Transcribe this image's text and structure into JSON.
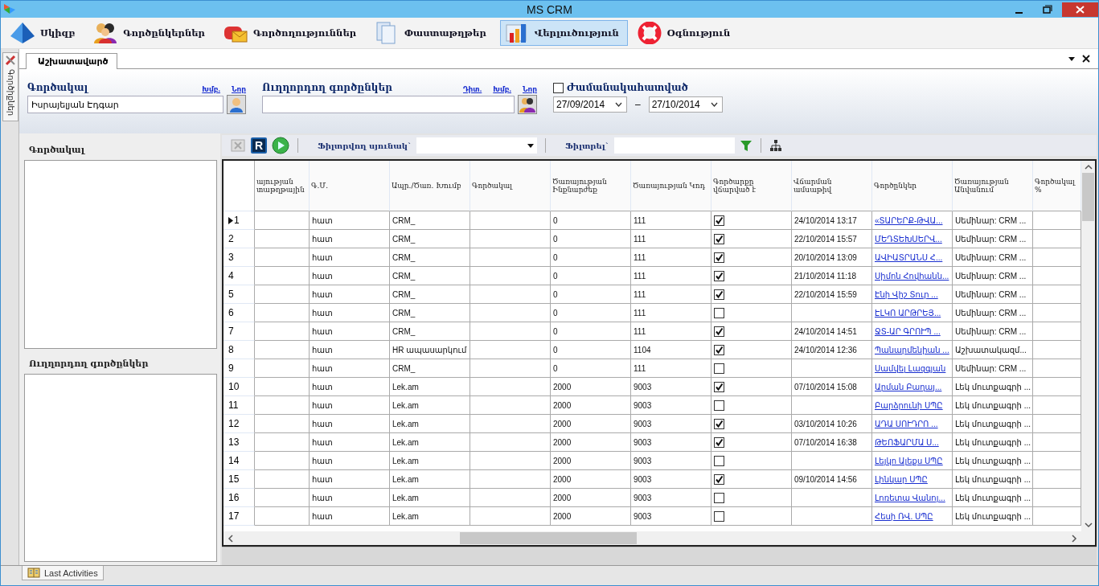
{
  "window": {
    "title": "MS CRM"
  },
  "menu": [
    {
      "label": "Սկիզբ",
      "selected": false
    },
    {
      "label": "Գործընկերներ",
      "selected": false
    },
    {
      "label": "Գործողություններ",
      "selected": false
    },
    {
      "label": "Փաստաթղթեր",
      "selected": false
    },
    {
      "label": "Վերլուծություն",
      "selected": true
    },
    {
      "label": "Օգնություն",
      "selected": false
    }
  ],
  "side_strip": {
    "label": "Գործիքներ"
  },
  "doc_tab": {
    "label": "Աշխատավարծ"
  },
  "form": {
    "agent": {
      "label": "Գործակալ",
      "links": [
        "Խմբ.",
        "Նոր"
      ],
      "value": "Իսրայելյան Էդգար"
    },
    "partner": {
      "label": "Ուղղորդող գործընկեր",
      "links": [
        "Դիտ.",
        "Խմբ.",
        "Նոր"
      ]
    },
    "period": {
      "label": "Ժամանակահատված",
      "checked": false,
      "from": "27/09/2014",
      "separator": "–",
      "to": "27/10/2014"
    }
  },
  "left_panel": {
    "agent_label": "Գործակալ",
    "partner_label": "Ուղղորդող գործընկեր"
  },
  "toolbar": {
    "report_button": "R",
    "filter_column_label": "Ֆիլտրվող սյունակ`",
    "filter_label": "Ֆիլտրել`"
  },
  "table": {
    "columns": [
      "այության տաթղթային",
      "Գ.Մ.",
      "Ապր./Ծառ. Խումբ",
      "Գործակալ",
      "Ծառայության Ինքնարժեք",
      "Ծառայության Կոդ",
      "Գործարքը վճարված է",
      "Վճարման ամսաթիվ",
      "Գործընկեր",
      "Ծառայության Անվանում",
      "Գործակալ %"
    ],
    "rows": [
      {
        "num": "1",
        "selected": true,
        "unit": "հատ",
        "group": "CRM_",
        "cost": "0",
        "code": "111",
        "paid": true,
        "date": "24/10/2014 13:17",
        "partner": "«ՏԱՐԵՐՔ-ԹՎԱ...",
        "service": "Սեմինար: CRM ..."
      },
      {
        "num": "2",
        "selected": false,
        "unit": "հատ",
        "group": "CRM_",
        "cost": "0",
        "code": "111",
        "paid": true,
        "date": "22/10/2014 15:57",
        "partner": "ՄԵԴՏԵԽՍԵՐՎ...",
        "service": "Սեմինար: CRM ..."
      },
      {
        "num": "3",
        "selected": false,
        "unit": "հատ",
        "group": "CRM_",
        "cost": "0",
        "code": "111",
        "paid": true,
        "date": "20/10/2014 13:09",
        "partner": "ԱՎԻԱՏՐԱՆՍ Հ...",
        "service": "Սեմինար: CRM ..."
      },
      {
        "num": "4",
        "selected": false,
        "unit": "հատ",
        "group": "CRM_",
        "cost": "0",
        "code": "111",
        "paid": true,
        "date": "21/10/2014 11:18",
        "partner": "Սիմոն Հովհանն...",
        "service": "Սեմինար: CRM ..."
      },
      {
        "num": "5",
        "selected": false,
        "unit": "հատ",
        "group": "CRM_",
        "cost": "0",
        "code": "111",
        "paid": true,
        "date": "22/10/2014 15:59",
        "partner": "Էնի Վիշ Տուր ...",
        "service": "Սեմինար: CRM ..."
      },
      {
        "num": "6",
        "selected": false,
        "unit": "հատ",
        "group": "CRM_",
        "cost": "0",
        "code": "111",
        "paid": false,
        "date": "",
        "partner": "ԷԼԿՈ ԱՐԹՐԵՅ...",
        "service": "Սեմինար: CRM ..."
      },
      {
        "num": "7",
        "selected": false,
        "unit": "հատ",
        "group": "CRM_",
        "cost": "0",
        "code": "111",
        "paid": true,
        "date": "24/10/2014 14:51",
        "partner": "ՋՏ-ԱՐ ԳՐՈՒՊ ...",
        "service": "Սեմինար: CRM ..."
      },
      {
        "num": "8",
        "selected": false,
        "unit": "հատ",
        "group": "HR ապասարկում",
        "cost": "0",
        "code": "1104",
        "paid": true,
        "date": "24/10/2014 12:36",
        "partner": "Պանարմենիան ...",
        "service": "Աշխատակազմ..."
      },
      {
        "num": "9",
        "selected": false,
        "unit": "հատ",
        "group": "CRM_",
        "cost": "0",
        "code": "111",
        "paid": false,
        "date": "",
        "partner": "Սամվել Լազգյան",
        "service": "Սեմինար: CRM ..."
      },
      {
        "num": "10",
        "selected": false,
        "unit": "հատ",
        "group": "Lek.am",
        "cost": "2000",
        "code": "9003",
        "paid": true,
        "date": "07/10/2014 15:08",
        "partner": "Արման Բաղայ...",
        "service": "Լեկ մուտքագրի ..."
      },
      {
        "num": "11",
        "selected": false,
        "unit": "հատ",
        "group": "Lek.am",
        "cost": "2000",
        "code": "9003",
        "paid": false,
        "date": "",
        "partner": "Բարձրունի  ՍՊԸ",
        "service": "Լեկ մուտքագրի ..."
      },
      {
        "num": "12",
        "selected": false,
        "unit": "հատ",
        "group": "Lek.am",
        "cost": "2000",
        "code": "9003",
        "paid": true,
        "date": "03/10/2014 10:26",
        "partner": "ԱԴԱ ՍՈՒԴՐՈ ...",
        "service": "Լեկ մուտքագրի ..."
      },
      {
        "num": "13",
        "selected": false,
        "unit": "հատ",
        "group": "Lek.am",
        "cost": "2000",
        "code": "9003",
        "paid": true,
        "date": "07/10/2014 16:38",
        "partner": "ԹԵՈՖԱՐՄԱ  Ս...",
        "service": "Լեկ մուտքագրի ..."
      },
      {
        "num": "14",
        "selected": false,
        "unit": "հատ",
        "group": "Lek.am",
        "cost": "2000",
        "code": "9003",
        "paid": false,
        "date": "",
        "partner": "Լեյկո Ալեքս  ՍՊԸ",
        "service": "Լեկ մուտքագրի ..."
      },
      {
        "num": "15",
        "selected": false,
        "unit": "հատ",
        "group": "Lek.am",
        "cost": "2000",
        "code": "9003",
        "paid": true,
        "date": "09/10/2014 14:56",
        "partner": "Լինկար  ՍՊԸ",
        "service": "Լեկ մուտքագրի ..."
      },
      {
        "num": "16",
        "selected": false,
        "unit": "հատ",
        "group": "Lek.am",
        "cost": "2000",
        "code": "9003",
        "paid": false,
        "date": "",
        "partner": "Լոռետա Վանոյ...",
        "service": "Լեկ մուտքագրի ..."
      },
      {
        "num": "17",
        "selected": false,
        "unit": "հատ",
        "group": "Lek.am",
        "cost": "2000",
        "code": "9003",
        "paid": false,
        "date": "",
        "partner": "Հեսի ՌՎ. ՍՊԸ",
        "service": "Լեկ մուտքագրի ..."
      }
    ]
  },
  "status_bar": {
    "tab": "Last Activities"
  }
}
